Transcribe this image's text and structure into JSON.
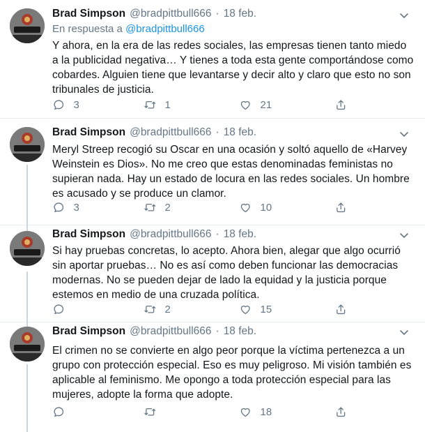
{
  "author": {
    "name": "Brad Simpson",
    "handle": "@bradpittbull666",
    "separator": "·",
    "avatar_icon": "tattoo-avatar-icon"
  },
  "icons": {
    "more": "chevron-down-icon",
    "reply": "reply-icon",
    "retweet": "retweet-icon",
    "like": "heart-icon",
    "share": "share-icon"
  },
  "colors": {
    "link": "#1b95e0",
    "secondary": "#657786",
    "text": "#14171a",
    "thread_line": "#ccd6dd"
  },
  "tweets": [
    {
      "date": "18 feb.",
      "reply_prefix": "En respuesta a ",
      "reply_handle": "@bradpittbull666",
      "text": "Y ahora, en la era de las redes sociales, las empresas tienen tanto miedo a la publicidad negativa… Y tienes a toda esta gente comportándose como cobardes. Alguien tiene que levantarse y decir alto y claro que esto no son tribunales de justicia.",
      "replies": "3",
      "retweets": "1",
      "likes": "21"
    },
    {
      "date": "18 feb.",
      "text": "Meryl Streep recogió su Oscar en una ocasión y soltó aquello de «Harvey Weinstein es Dios». No me creo que estas denominadas feministas no supieran nada. Hay un estado de locura en las redes sociales. Un hombre es acusado y se produce un clamor.",
      "replies": "3",
      "retweets": "2",
      "likes": "10"
    },
    {
      "date": "18 feb.",
      "text": "Si hay pruebas concretas, lo acepto. Ahora bien, alegar que algo ocurrió sin aportar pruebas… No es así como deben funcionar las democracias modernas. No se pueden dejar de lado la equidad y la justicia porque estemos en medio de una cruzada política.",
      "replies": "",
      "retweets": "2",
      "likes": "15"
    },
    {
      "date": "18 feb.",
      "text": "El crimen no se convierte en algo peor porque la víctima pertenezca a un grupo con protección especial. Eso es muy peligroso.  Mi visión también es aplicable al feminismo. Me opongo a toda protección especial para las mujeres, adopte la forma que adopte.",
      "replies": "",
      "retweets": "",
      "likes": "18"
    }
  ]
}
